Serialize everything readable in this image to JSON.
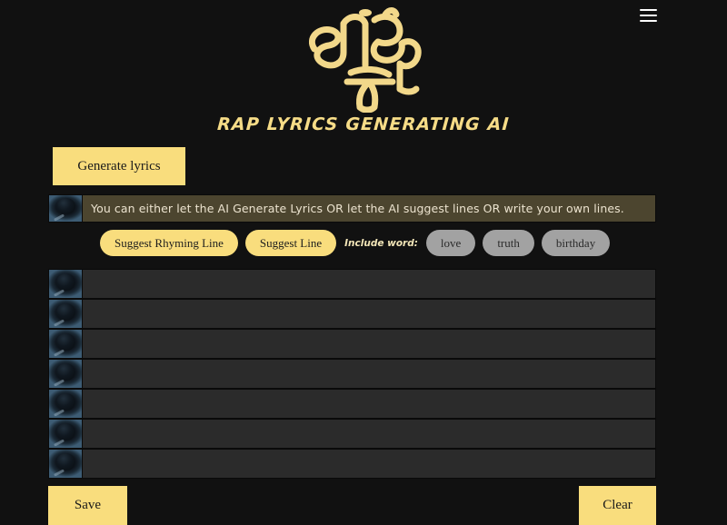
{
  "app": {
    "logo_alt": "Hip Hop graffiti logo",
    "tagline": "RAP LYRICS GENERATING AI",
    "accent_color": "#f9dd7d",
    "background_color": "#111111",
    "info_bar_color": "#4c452f",
    "pill_gray_color": "#a2a2a2",
    "mic_icon_name": "microphone-icon"
  },
  "header": {
    "menu_icon": "hamburger-menu-icon"
  },
  "toolbar": {
    "generate_label": "Generate lyrics"
  },
  "info": {
    "message": "You can either let the AI Generate Lyrics OR let the AI suggest lines OR write your own lines."
  },
  "suggest": {
    "rhyming_label": "Suggest Rhyming Line",
    "line_label": "Suggest Line",
    "include_word_label": "Include word:",
    "words": [
      "love",
      "truth",
      "birthday"
    ]
  },
  "lyrics": {
    "rows": [
      {
        "value": "",
        "placeholder": ""
      },
      {
        "value": "",
        "placeholder": ""
      },
      {
        "value": "",
        "placeholder": ""
      },
      {
        "value": "",
        "placeholder": ""
      },
      {
        "value": "",
        "placeholder": ""
      },
      {
        "value": "",
        "placeholder": ""
      },
      {
        "value": "",
        "placeholder": ""
      }
    ]
  },
  "footer": {
    "save_label": "Save",
    "clear_label": "Clear"
  }
}
